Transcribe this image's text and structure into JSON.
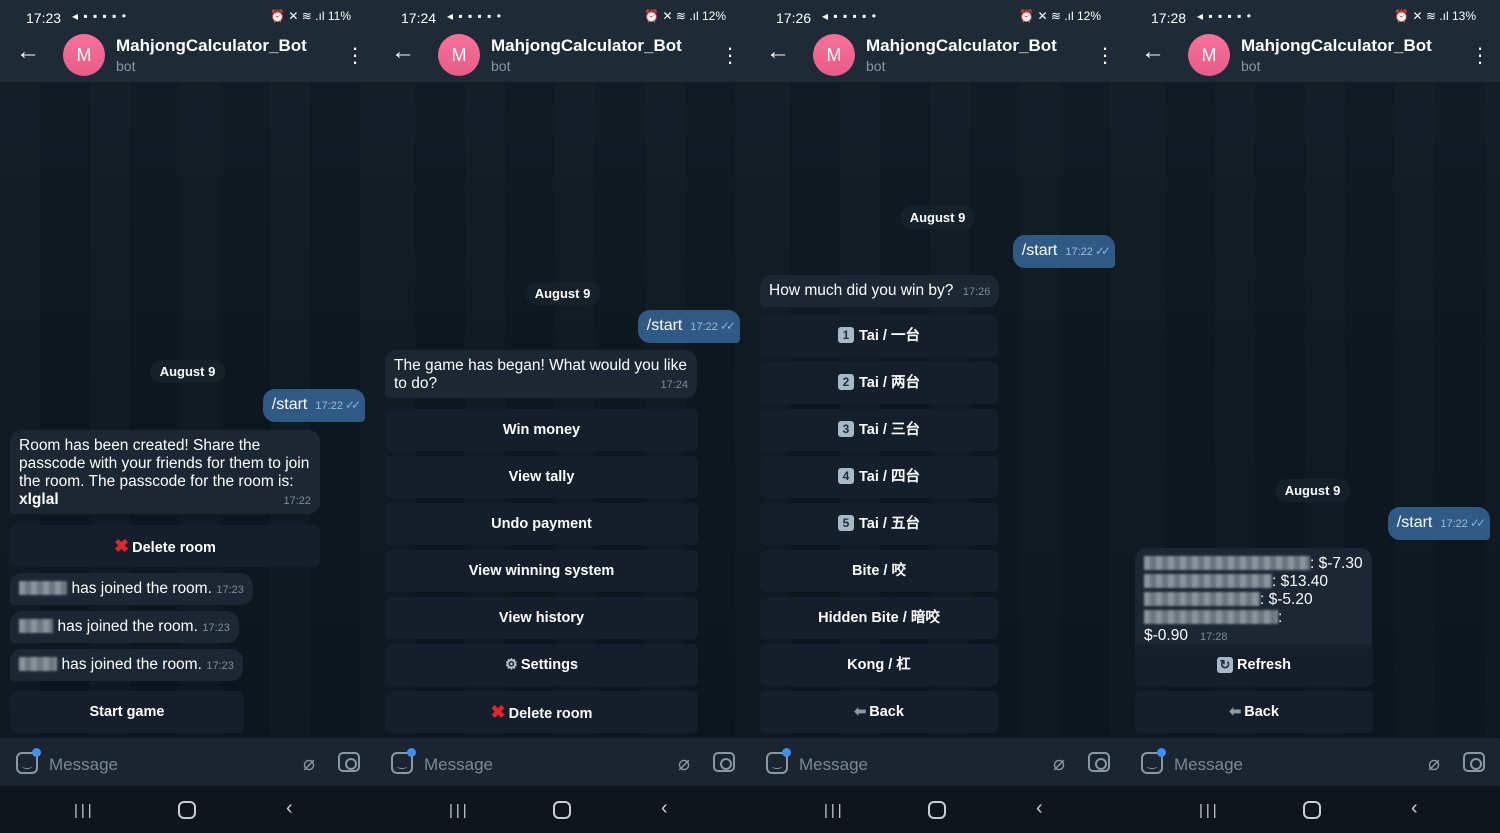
{
  "app": {
    "bot_name": "MahjongCalculator_Bot",
    "bot_sub": "bot",
    "avatar_letter": "M",
    "message_placeholder": "Message"
  },
  "common": {
    "date": "August 9",
    "start_cmd": "/start",
    "start_time": "17:22",
    "checks": "✓✓"
  },
  "screens": [
    {
      "status": {
        "time": "17:23",
        "battery": "11%"
      },
      "room_msg": {
        "text": "Room has been created! Share the passcode with your friends for them to join the room. The passcode for the room is: ",
        "passcode": "xlglal",
        "time": "17:22"
      },
      "delete_room": "Delete room",
      "joined": [
        {
          "text": "has joined the room.",
          "time": "17:23"
        },
        {
          "text": "has joined the room.",
          "time": "17:23"
        },
        {
          "text": "has joined the room.",
          "time": "17:23"
        }
      ],
      "start_game": "Start game"
    },
    {
      "status": {
        "time": "17:24",
        "battery": "12%"
      },
      "msg": {
        "text": "The game has began! What would you like to do?",
        "time": "17:24"
      },
      "buttons": [
        "Win money",
        "View tally",
        "Undo payment",
        "View winning system",
        "View history",
        "Settings",
        "Delete room"
      ]
    },
    {
      "status": {
        "time": "17:26",
        "battery": "12%"
      },
      "msg": {
        "text": "How much did you win by?",
        "time": "17:26"
      },
      "buttons": [
        {
          "num": "1",
          "label": "Tai / 一台"
        },
        {
          "num": "2",
          "label": "Tai / 两台"
        },
        {
          "num": "3",
          "label": "Tai / 三台"
        },
        {
          "num": "4",
          "label": "Tai / 四台"
        },
        {
          "num": "5",
          "label": "Tai / 五台"
        },
        {
          "label": "Bite / 咬"
        },
        {
          "label": "Hidden Bite / 暗咬"
        },
        {
          "label": "Kong / 杠"
        },
        {
          "label": "Back"
        }
      ]
    },
    {
      "status": {
        "time": "17:28",
        "battery": "13%"
      },
      "tally": {
        "rows": [
          ": $-7.30",
          ": $13.40",
          ": $-5.20",
          ": $-0.90"
        ],
        "time": "17:28"
      },
      "refresh": "Refresh",
      "back": "Back"
    }
  ]
}
